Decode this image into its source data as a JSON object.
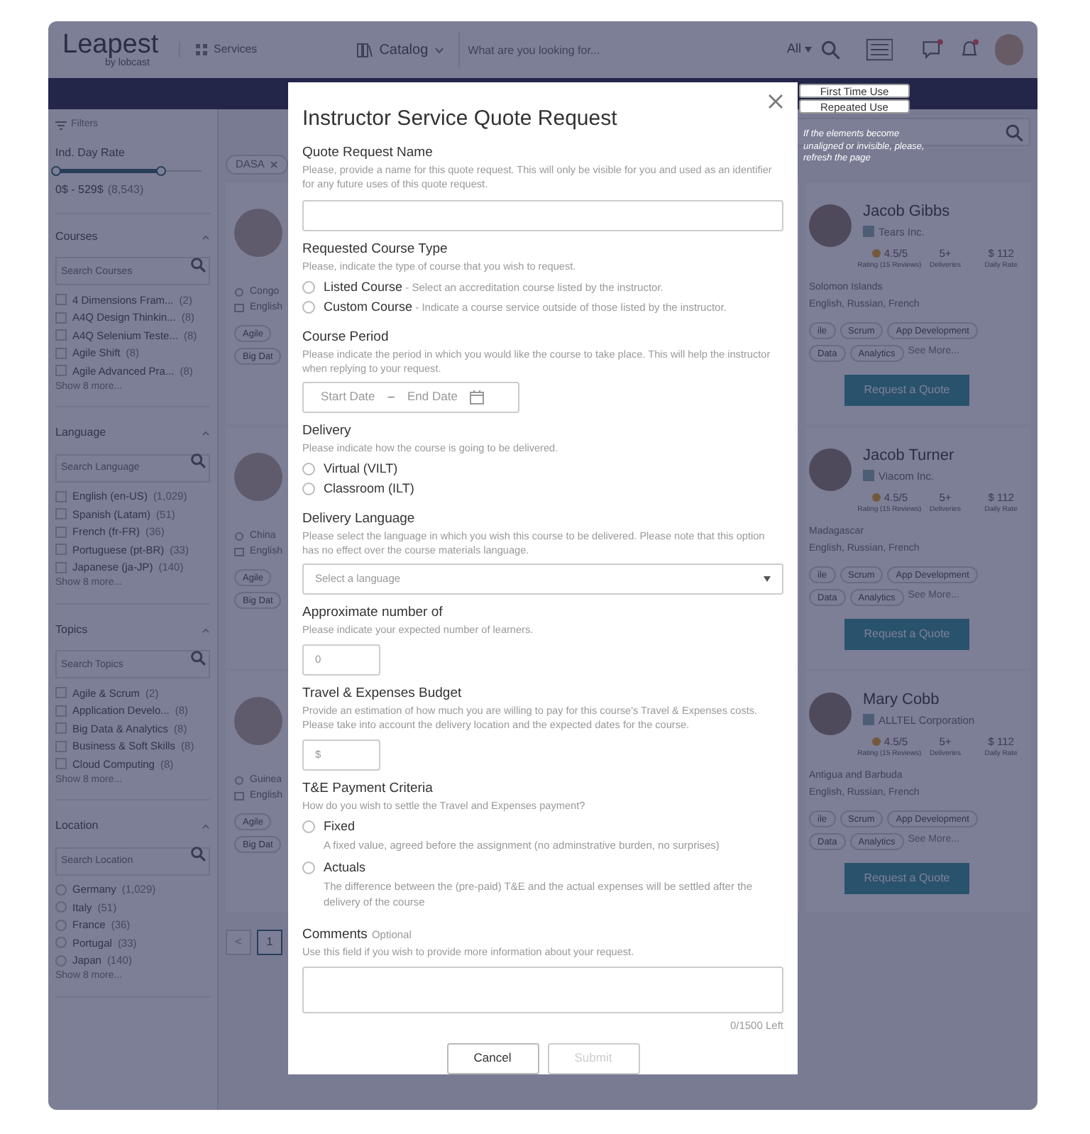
{
  "header": {
    "logo": "Leapest",
    "logo_sub": "by lobcast",
    "services": "Services",
    "catalog": "Catalog",
    "search_placeholder": "What are you looking for...",
    "scope": "All"
  },
  "sidebar": {
    "title": "Filters",
    "rate": {
      "label": "Ind. Day Rate",
      "level": 0.72,
      "range": "0$ - 529$",
      "count": "(8,543)"
    },
    "sections": [
      {
        "title": "Courses",
        "kind": "check",
        "placeholder": "Search Courses",
        "items": [
          {
            "label": "4 Dimensions Fram...",
            "count": "(2)",
            "checked": false
          },
          {
            "label": "A4Q Design Thinkin...",
            "count": "(8)",
            "checked": false
          },
          {
            "label": "A4Q Selenium Teste...",
            "count": "(8)",
            "checked": false
          },
          {
            "label": "Agile Shift",
            "count": "(8)",
            "checked": false
          },
          {
            "label": "Agile Advanced Pra...",
            "count": "(8)",
            "checked": false
          }
        ],
        "more": "Show 8 more..."
      },
      {
        "title": "Language",
        "kind": "check",
        "placeholder": "Search Language",
        "items": [
          {
            "label": "English (en-US)",
            "count": "(1,029)",
            "checked": false
          },
          {
            "label": "Spanish (Latam)",
            "count": "(51)",
            "checked": false
          },
          {
            "label": "French (fr-FR)",
            "count": "(36)",
            "checked": false
          },
          {
            "label": "Portuguese (pt-BR)",
            "count": "(33)",
            "checked": false
          },
          {
            "label": "Japanese (ja-JP)",
            "count": "(140)",
            "checked": false
          }
        ],
        "more": "Show 8 more..."
      },
      {
        "title": "Topics",
        "kind": "check",
        "placeholder": "Search Topics",
        "items": [
          {
            "label": "Agile & Scrum",
            "count": "(2)",
            "checked": false
          },
          {
            "label": "Application Develo...",
            "count": "(8)",
            "checked": false
          },
          {
            "label": "Big Data & Analytics",
            "count": "(8)",
            "checked": false
          },
          {
            "label": "Business & Soft Skills",
            "count": "(8)",
            "checked": false
          },
          {
            "label": "Cloud Computing",
            "count": "(8)",
            "checked": false
          }
        ],
        "more": "Show 8 more..."
      },
      {
        "title": "Location",
        "kind": "radio",
        "placeholder": "Search Location",
        "items": [
          {
            "label": "Germany",
            "count": "(1,029)",
            "selected": false
          },
          {
            "label": "Italy",
            "count": "(51)",
            "selected": false
          },
          {
            "label": "France",
            "count": "(36)",
            "selected": false
          },
          {
            "label": "Portugal",
            "count": "(33)",
            "selected": false
          },
          {
            "label": "Japan",
            "count": "(140)",
            "selected": false
          }
        ],
        "more": "Show 8 more..."
      }
    ]
  },
  "chip": {
    "label": "DASA"
  },
  "rows": [
    {
      "left": {
        "location": "Congo",
        "language": "English",
        "tags": [
          "Agile",
          "Big Dat"
        ]
      },
      "right": {
        "name": "Jacob Gibbs",
        "company": "Tears Inc.",
        "rating": "4.5/5",
        "rating_label": "Rating (15 Reviews)",
        "deliveries": "5+",
        "deliveries_label": "Deliveries",
        "rate": "$ 112",
        "rate_label": "Daily Rate",
        "location": "Solomon Islands",
        "languages": "English, Russian, French",
        "tags": [
          "ile",
          "Scrum",
          "App Development"
        ],
        "tags2": [
          "Data",
          "Analytics"
        ],
        "more": "See More...",
        "button": "Request a Quote"
      }
    },
    {
      "left": {
        "location": "China",
        "language": "English",
        "tags": [
          "Agile",
          "Big Dat"
        ]
      },
      "right": {
        "name": "Jacob Turner",
        "company": "Viacom Inc.",
        "rating": "4.5/5",
        "rating_label": "Rating (15 Reviews)",
        "deliveries": "5+",
        "deliveries_label": "Deliveries",
        "rate": "$ 112",
        "rate_label": "Daily Rate",
        "location": "Madagascar",
        "languages": "English, Russian, French",
        "tags": [
          "ile",
          "Scrum",
          "App Development"
        ],
        "tags2": [
          "Data",
          "Analytics"
        ],
        "more": "See More...",
        "button": "Request a Quote"
      }
    },
    {
      "left": {
        "location": "Guinea",
        "language": "English",
        "tags": [
          "Agile",
          "Big Dat"
        ]
      },
      "right": {
        "name": "Mary Cobb",
        "company": "ALLTEL Corporation",
        "rating": "4.5/5",
        "rating_label": "Rating (15 Reviews)",
        "deliveries": "5+",
        "deliveries_label": "Deliveries",
        "rate": "$ 112",
        "rate_label": "Daily Rate",
        "location": "Antigua and Barbuda",
        "languages": "English, Russian, French",
        "tags": [
          "ile",
          "Scrum",
          "App Development"
        ],
        "tags2": [
          "Data",
          "Analytics"
        ],
        "more": "See More...",
        "button": "Request a Quote"
      }
    }
  ],
  "pagination": {
    "prev": "<",
    "page": "1"
  },
  "helper": {
    "buttons": [
      "First Time Use",
      "Repeated Use"
    ],
    "note": "If the elements become unaligned or invisible, please, refresh the page"
  },
  "modal": {
    "title": "Instructor Service Quote Request",
    "fields": [
      {
        "kind": "text",
        "label": "Quote Request Name",
        "help": "Please, provide a name for this quote request. This will only be visible for you and used as an identifier for any future uses of this quote request."
      },
      {
        "kind": "radio",
        "label": "Requested Course Type",
        "help": "Please, indicate the type of course that you wish to request.",
        "options": [
          {
            "label": "Listed Course",
            "note": " - Select an accreditation course listed by the instructor.",
            "selected": false
          },
          {
            "label": "Custom Course",
            "note": " - Indicate a course service outside of those listed by the instructor.",
            "selected": false
          }
        ]
      },
      {
        "kind": "date",
        "label": "Course Period",
        "help": "Please indicate the period in which you would like the course to take place. This will help the instructor when replying to your request.",
        "start": "Start Date",
        "separator": "–",
        "end": "End Date"
      },
      {
        "kind": "radio",
        "label": "Delivery",
        "help": "Please indicate how the course is going to be delivered.",
        "options": [
          {
            "label": "Virtual (VILT)",
            "selected": false
          },
          {
            "label": "Classroom (ILT)",
            "selected": false
          }
        ]
      },
      {
        "kind": "select",
        "label": "Delivery Language",
        "help": "Please select the language in which you wish this course to be delivered. Please note that this option has no effect over the course materials language.",
        "placeholder": "Select a language"
      },
      {
        "kind": "short",
        "label": "Approximate number of",
        "help": "Please indicate your expected number of learners.",
        "placeholder": "0"
      },
      {
        "kind": "short",
        "label": "Travel & Expenses Budget",
        "help": "Provide an estimation of how much you are willing to pay for this course's Travel & Expenses costs. Please take into account the delivery location and the expected dates for the course.",
        "placeholder": "$"
      },
      {
        "kind": "radio",
        "label": "T&E Payment Criteria",
        "help": "How do you wish to settle the Travel and Expenses payment?",
        "options": [
          {
            "label": "Fixed",
            "desc": "A fixed value, agreed before the assignment (no adminstrative burden, no surprises)",
            "selected": false
          },
          {
            "label": "Actuals",
            "desc": "The difference between the (pre-paid) T&E and the actual expenses will be settled after the delivery of the course",
            "selected": false
          }
        ]
      },
      {
        "kind": "textarea",
        "label": "Comments",
        "optional": "Optional",
        "help": "Use this field if you wish to provide more information about your request.",
        "counter": "0/1500 Left"
      }
    ],
    "cancel": "Cancel",
    "submit": {
      "label": "Submit",
      "disabled": true
    }
  }
}
